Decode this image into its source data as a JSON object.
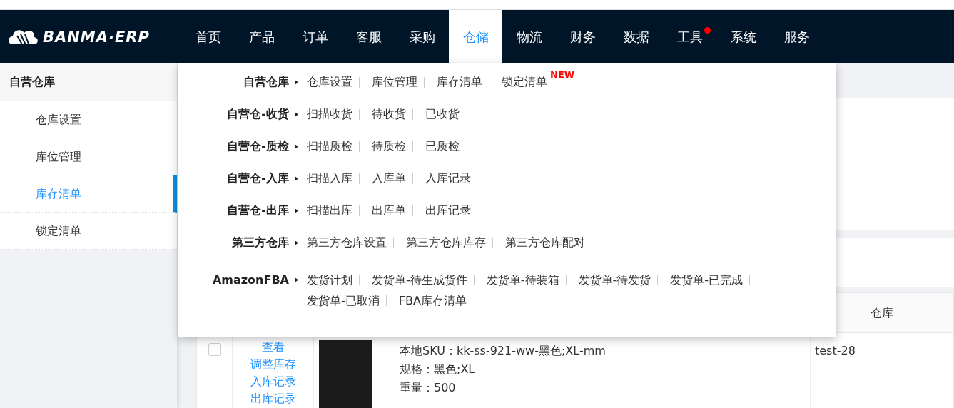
{
  "nav": {
    "logo": "BANMA·ERP",
    "items": [
      {
        "label": "首页",
        "selected": false,
        "dot": false
      },
      {
        "label": "产品",
        "selected": false,
        "dot": false
      },
      {
        "label": "订单",
        "selected": false,
        "dot": false
      },
      {
        "label": "客服",
        "selected": false,
        "dot": false
      },
      {
        "label": "采购",
        "selected": false,
        "dot": false
      },
      {
        "label": "仓储",
        "selected": true,
        "dot": false
      },
      {
        "label": "物流",
        "selected": false,
        "dot": false
      },
      {
        "label": "财务",
        "selected": false,
        "dot": false
      },
      {
        "label": "数据",
        "selected": false,
        "dot": false
      },
      {
        "label": "工具",
        "selected": false,
        "dot": true
      },
      {
        "label": "系统",
        "selected": false,
        "dot": false
      },
      {
        "label": "服务",
        "selected": false,
        "dot": false
      }
    ]
  },
  "sidebar": {
    "title": "自营仓库",
    "items": [
      {
        "label": "仓库设置",
        "selected": false
      },
      {
        "label": "库位管理",
        "selected": false
      },
      {
        "label": "库存清单",
        "selected": true
      },
      {
        "label": "锁定清单",
        "selected": false
      }
    ]
  },
  "dropdown": {
    "groups": [
      {
        "title": "自营仓库",
        "links": [
          {
            "label": "仓库设置"
          },
          {
            "label": "库位管理"
          },
          {
            "label": "库存清单"
          },
          {
            "label": "锁定清单",
            "badge": "NEW"
          }
        ]
      },
      {
        "title": "自营仓-收货",
        "links": [
          {
            "label": "扫描收货"
          },
          {
            "label": "待收货"
          },
          {
            "label": "已收货"
          }
        ]
      },
      {
        "title": "自营仓-质检",
        "links": [
          {
            "label": "扫描质检"
          },
          {
            "label": "待质检"
          },
          {
            "label": "已质检"
          }
        ]
      },
      {
        "title": "自营仓-入库",
        "links": [
          {
            "label": "扫描入库"
          },
          {
            "label": "入库单"
          },
          {
            "label": "入库记录"
          }
        ]
      },
      {
        "title": "自营仓-出库",
        "links": [
          {
            "label": "扫描出库"
          },
          {
            "label": "出库单"
          },
          {
            "label": "出库记录"
          }
        ]
      },
      {
        "title": "第三方仓库",
        "links": [
          {
            "label": "第三方仓库设置"
          },
          {
            "label": "第三方仓库库存"
          },
          {
            "label": "第三方仓库配对"
          }
        ]
      },
      {
        "title": "AmazonFBA",
        "links": [
          {
            "label": "发货计划"
          },
          {
            "label": "发货单-待生成货件"
          },
          {
            "label": "发货单-待装箱"
          },
          {
            "label": "发货单-待发货"
          },
          {
            "label": "发货单-已完成"
          },
          {
            "label": "发货单-已取消"
          },
          {
            "label": "FBA库存清单"
          }
        ]
      }
    ]
  },
  "table": {
    "columns": [
      "仓库"
    ],
    "rows": [
      {
        "checked": false,
        "actions": [
          "查看",
          "调整库存",
          "入库记录",
          "出库记录"
        ],
        "sku_lines": [
          "本地SKU：kk-ss-921-ww-黑色;XL-mm",
          "规格：黑色;XL",
          "重量：500"
        ],
        "warehouse": "test-28"
      }
    ]
  }
}
